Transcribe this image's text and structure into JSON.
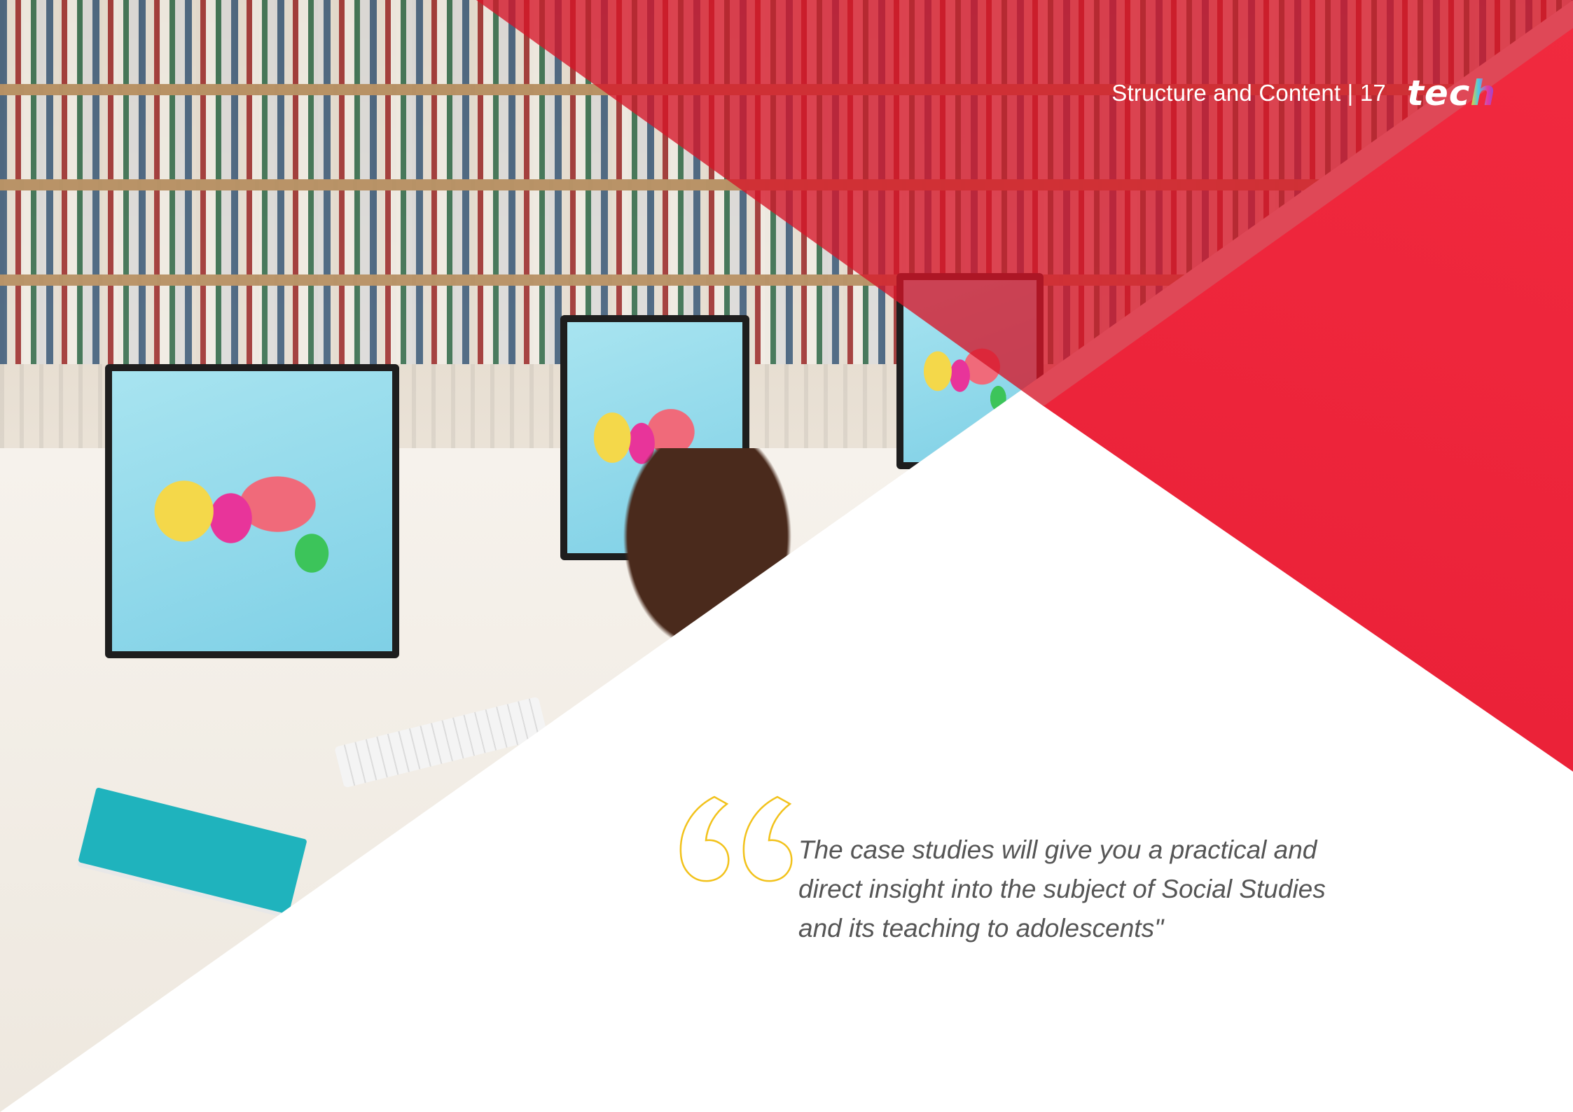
{
  "header": {
    "section_title": "Structure and Content | 17",
    "logo_text": "tec",
    "logo_last_letter": "h"
  },
  "photo": {
    "description_icon": "classroom-photo"
  },
  "quote": {
    "icon": "quote-open-icon",
    "lines": [
      "The case studies will give you a practical and",
      "direct insight into the subject of Social Studies",
      "and its teaching to adolescents\""
    ]
  },
  "colors": {
    "accent_red": "#e91f36",
    "quote_mark_yellow": "#f2c21b",
    "quote_text": "#555555"
  }
}
